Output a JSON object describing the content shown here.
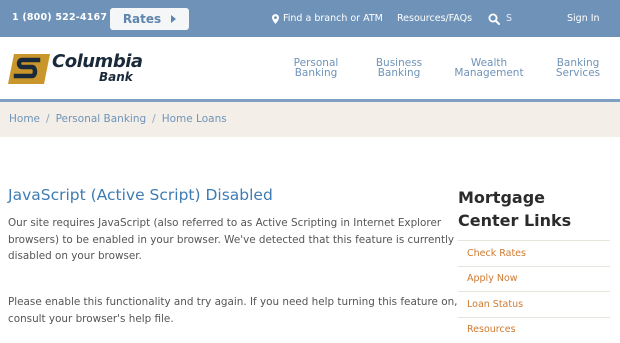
{
  "topbar": {
    "phone": "1 (800) 522-4167",
    "rates_label": "Rates",
    "find_branch": "Find a branch or ATM",
    "resources": "Resources/FAQs",
    "search_placeholder": "S",
    "sign_in": "Sign In"
  },
  "header": {
    "logo_name": "Columbia",
    "logo_sub": "Bank",
    "nav": [
      {
        "line1": "Personal",
        "line2": "Banking"
      },
      {
        "line1": "Business",
        "line2": "Banking"
      },
      {
        "line1": "Wealth",
        "line2": "Management"
      },
      {
        "line1": "Banking",
        "line2": "Services"
      }
    ]
  },
  "breadcrumb": {
    "items": [
      "Home",
      "Personal Banking",
      "Home Loans"
    ],
    "separator": "/"
  },
  "main": {
    "title": "JavaScript (Active Script) Disabled",
    "paragraph1": "Our site requires JavaScript (also referred to as Active Scripting in Internet Explorer browsers) to be enabled in your browser. We've detected that this feature is currently disabled on your browser.",
    "paragraph2": "Please enable this functionality and try again. If you need help turning this feature on, consult your browser's help file."
  },
  "sidebar": {
    "title_line1": "Mortgage",
    "title_line2": "Center Links",
    "links": [
      "Check Rates",
      "Apply Now",
      "Loan Status",
      "Resources"
    ]
  },
  "colors": {
    "topbar": "#6f93b8",
    "accent_blue": "#3f7cb3",
    "link_orange": "#d07a2e",
    "breadcrumb_bg": "#f3efe8",
    "logo_gold": "#c9962b"
  }
}
